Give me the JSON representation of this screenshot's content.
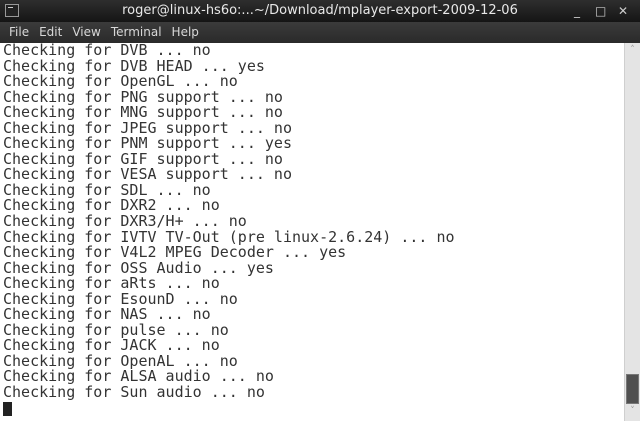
{
  "window": {
    "title": "roger@linux-hs6o:...~/Download/mplayer-export-2009-12-06",
    "minimize": "_",
    "maximize": "□",
    "close": "✕"
  },
  "menu": [
    "File",
    "Edit",
    "View",
    "Terminal",
    "Help"
  ],
  "lines": [
    "Checking for DVB ... no",
    "Checking for DVB HEAD ... yes",
    "Checking for OpenGL ... no",
    "Checking for PNG support ... no",
    "Checking for MNG support ... no",
    "Checking for JPEG support ... no",
    "Checking for PNM support ... yes",
    "Checking for GIF support ... no",
    "Checking for VESA support ... no",
    "Checking for SDL ... no",
    "Checking for DXR2 ... no",
    "Checking for DXR3/H+ ... no",
    "Checking for IVTV TV-Out (pre linux-2.6.24) ... no",
    "Checking for V4L2 MPEG Decoder ... yes",
    "Checking for OSS Audio ... yes",
    "Checking for aRts ... no",
    "Checking for EsounD ... no",
    "Checking for NAS ... no",
    "Checking for pulse ... no",
    "Checking for JACK ... no",
    "Checking for OpenAL ... no",
    "Checking for ALSA audio ... no",
    "Checking for Sun audio ... no"
  ],
  "scrollbar": {
    "up": "˄",
    "down": "˅",
    "position": 0.95
  }
}
